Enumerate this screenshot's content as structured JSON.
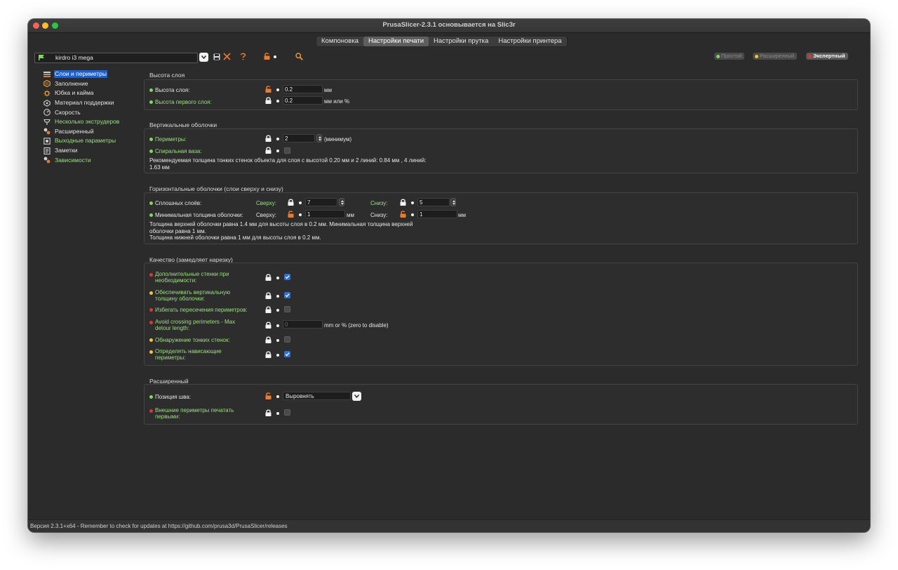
{
  "window": {
    "title": "PrusaSlicer-2.3.1 основывается на Slic3r"
  },
  "tabs": [
    {
      "label": "Компоновка",
      "active": false
    },
    {
      "label": "Настройки печати",
      "active": true
    },
    {
      "label": "Настройки прутка",
      "active": false
    },
    {
      "label": "Настройки принтера",
      "active": false
    }
  ],
  "preset": {
    "name": "kirdro i3 mega"
  },
  "modes": {
    "simple": {
      "label": "Простой",
      "color": "#7ed957"
    },
    "advanced": {
      "label": "Расширенный",
      "color": "#f4c430"
    },
    "expert": {
      "label": "Экспертный",
      "color": "#e0362c"
    }
  },
  "sidebar": {
    "items": [
      {
        "label": "Слои и периметры",
        "icon": "layers-icon",
        "selected": true
      },
      {
        "label": "Заполнение",
        "icon": "infill-icon"
      },
      {
        "label": "Юбка и кайма",
        "icon": "skirt-icon"
      },
      {
        "label": "Материал поддержки",
        "icon": "support-icon"
      },
      {
        "label": "Скорость",
        "icon": "speed-icon"
      },
      {
        "label": "Несколько экструдеров",
        "icon": "extruders-icon"
      },
      {
        "label": "Расширенный",
        "icon": "advanced-icon"
      },
      {
        "label": "Выходные параметры",
        "icon": "output-icon"
      },
      {
        "label": "Заметки",
        "icon": "notes-icon"
      },
      {
        "label": "Зависимости",
        "icon": "dependencies-icon"
      }
    ]
  },
  "layer_height": {
    "title": "Высота слоя",
    "layer_height": {
      "label": "Высота слоя:",
      "value": "0.2",
      "unit": "мм"
    },
    "first_layer_height": {
      "label": "Высота первого слоя:",
      "value": "0.2",
      "unit": "мм или %"
    }
  },
  "vertical_shells": {
    "title": "Вертикальные оболочки",
    "perimeters": {
      "label": "Периметры:",
      "value": "2",
      "unit": "(минимум)"
    },
    "spiral_vase": {
      "label": "Спиральная ваза:"
    },
    "note_line1": "Рекомендуемая толщина тонких стенок объекта для слоя с высотой 0.20 мм и 2 линий: 0.84 мм , 4 линий:",
    "note_line2": "1.63 мм"
  },
  "horizontal_shells": {
    "title": "Горизонтальные оболочки (слои сверху и снизу)",
    "solid_layers": {
      "label": "Сплошных слоёв:",
      "top_label": "Сверху:",
      "top_value": "7",
      "bottom_label": "Снизу:",
      "bottom_value": "5"
    },
    "min_thickness": {
      "label": "Минимальная толщина оболочки:",
      "top_label": "Сверху:",
      "top_value": "1",
      "top_unit": "мм",
      "bottom_label": "Снизу:",
      "bottom_value": "1",
      "bottom_unit": "мм"
    },
    "note_line1": "Толщина верхней оболочки равна 1.4 мм для высоты слоя в 0.2 мм. Минимальная толщина верхней",
    "note_line2": "оболочки равна 1 мм.",
    "note_line3": "Толщина нижней оболочки равна 1 мм для высоты слоя в 0.2 мм."
  },
  "quality": {
    "title": "Качество (замедляет нарезку)",
    "extra_perimeters": {
      "label": "Дополнительные стенки при необходимости:",
      "checked": true
    },
    "ensure_vertical": {
      "label": "Обеспечивать вертикальную толщину оболочки:",
      "checked": true
    },
    "avoid_crossing": {
      "label": "Избегать пересечения периметров:",
      "checked": false
    },
    "avoid_crossing_max": {
      "label": "Avoid crossing perimeters - Max detour length:",
      "value": "0",
      "unit": "mm or % (zero to disable)"
    },
    "thin_walls": {
      "label": "Обнаружение тонких стенок:",
      "checked": false
    },
    "overhangs": {
      "label": "Определять нависающие периметры:",
      "checked": true
    }
  },
  "advanced": {
    "title": "Расширенный",
    "seam_position": {
      "label": "Позиция шва:",
      "value": "Выровнять"
    },
    "external_first": {
      "label": "Внешние периметры печатать первыми:",
      "checked": false
    }
  },
  "statusbar": {
    "text": "Версия 2.3.1+x64 - Remember to check for updates at https://github.com/prusa3d/PrusaSlicer/releases"
  }
}
